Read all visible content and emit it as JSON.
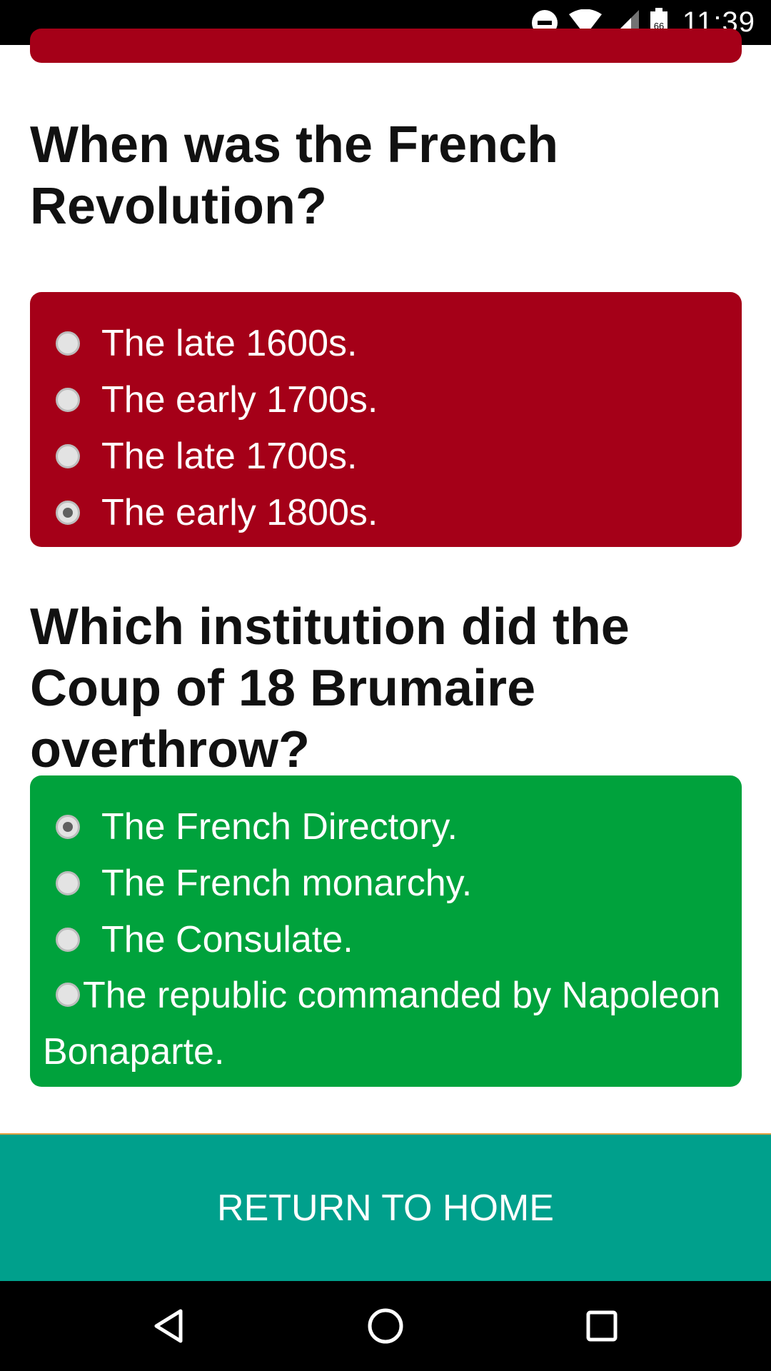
{
  "status_bar": {
    "time": "11:39",
    "icons": [
      "do-not-disturb-icon",
      "wifi-icon",
      "cellular-signal-icon",
      "battery-icon"
    ]
  },
  "questions": [
    {
      "title": "When was the French Revolution?",
      "card_color": "#a50018",
      "options": [
        {
          "label": "The late 1600s.",
          "selected": false
        },
        {
          "label": "The early 1700s.",
          "selected": false
        },
        {
          "label": "The late 1700s.",
          "selected": false
        },
        {
          "label": "The early 1800s.",
          "selected": true
        }
      ]
    },
    {
      "title": "Which institution did the Coup of 18 Brumaire overthrow?",
      "card_color": "#00a23c",
      "options": [
        {
          "label": "The French Directory.",
          "selected": true
        },
        {
          "label": "The French monarchy.",
          "selected": false
        },
        {
          "label": "The Consulate.",
          "selected": false
        },
        {
          "label": "The republic commanded by Napoleon Bonaparte.",
          "selected": false
        }
      ]
    }
  ],
  "return_button": {
    "label": "RETURN TO HOME",
    "color": "#00a08c"
  },
  "nav_bar": {
    "icons": [
      "back-icon",
      "home-icon",
      "recents-icon"
    ]
  }
}
